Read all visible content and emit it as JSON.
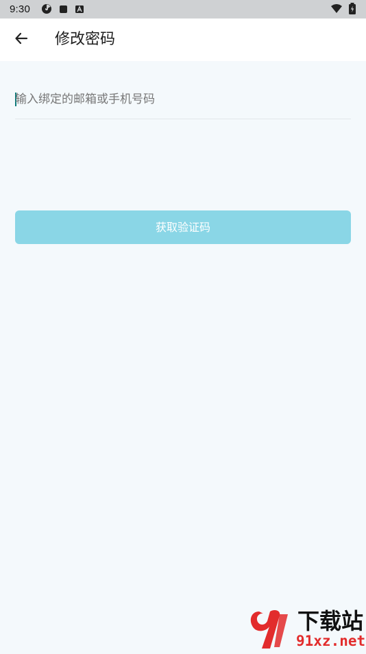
{
  "status_bar": {
    "time": "9:30",
    "left_icons": [
      "radioactive-icon",
      "square-app-icon",
      "a-badge-icon"
    ],
    "right_icons": [
      "wifi-icon",
      "battery-charging-icon"
    ]
  },
  "app_bar": {
    "back_icon": "arrow-left-icon",
    "title": "修改密码"
  },
  "form": {
    "account_input": {
      "value": "",
      "placeholder": "输入绑定的邮箱或手机号码"
    },
    "get_code_button": "获取验证码"
  },
  "watermark": {
    "name": "下载站",
    "site": "91xz.net"
  },
  "colors": {
    "status_bar_bg": "#cfd1d3",
    "app_bar_bg": "#ffffff",
    "content_bg": "#f4f9fc",
    "button_bg": "#8ad6e6",
    "button_text": "#ffffff",
    "cursor": "#0b7a7a",
    "watermark_red": "#e22c2c"
  }
}
